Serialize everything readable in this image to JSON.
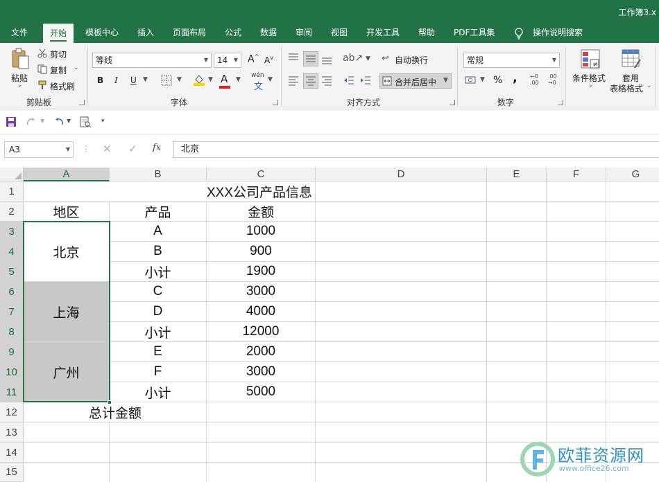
{
  "window": {
    "title": "工作簿3.x"
  },
  "tabs": [
    {
      "label": "文件"
    },
    {
      "label": "开始"
    },
    {
      "label": "模板中心"
    },
    {
      "label": "插入"
    },
    {
      "label": "页面布局"
    },
    {
      "label": "公式"
    },
    {
      "label": "数据"
    },
    {
      "label": "审阅"
    },
    {
      "label": "视图"
    },
    {
      "label": "开发工具"
    },
    {
      "label": "帮助"
    },
    {
      "label": "PDF工具集"
    },
    {
      "label": "操作说明搜索"
    }
  ],
  "active_tab": "开始",
  "ribbon": {
    "clipboard": {
      "paste": "粘贴",
      "cut": "剪切",
      "copy": "复制",
      "format_painter": "格式刷",
      "label": "剪贴板"
    },
    "font": {
      "name": "等线",
      "size": "14",
      "bold": "B",
      "italic": "I",
      "underline": "U",
      "label": "字体",
      "grow": "A",
      "shrink": "A",
      "font_color_letter": "A",
      "phonetic": "wén"
    },
    "alignment": {
      "wrap": "自动换行",
      "merge": "合并后居中",
      "label": "对齐方式"
    },
    "number": {
      "format": "常规",
      "percent": "%",
      "comma": ",",
      "label": "数字"
    },
    "styles": {
      "conditional": "条件格式",
      "table_line1": "套用",
      "table_line2": "表格格式"
    }
  },
  "formula_bar": {
    "name_box": "A3",
    "fx": "fx",
    "value": "北京"
  },
  "columns": [
    "A",
    "B",
    "C",
    "D",
    "E",
    "F",
    "G"
  ],
  "rows": [
    "1",
    "2",
    "3",
    "4",
    "5",
    "6",
    "7",
    "8",
    "9",
    "10",
    "11",
    "12",
    "13",
    "14",
    "15"
  ],
  "sheet": {
    "title": "XXX公司产品信息",
    "headers": [
      "地区",
      "产品",
      "金额"
    ],
    "regions": [
      "北京",
      "上海",
      "广州"
    ],
    "products": [
      "A",
      "B",
      "小计",
      "C",
      "D",
      "小计",
      "E",
      "F",
      "小计"
    ],
    "amounts": [
      "1000",
      "900",
      "1900",
      "3000",
      "4000",
      "12000",
      "2000",
      "3000",
      "5000"
    ],
    "total_label": "总计金额"
  },
  "colors": {
    "brand": "#217346",
    "region_fill": "#c8c8c8"
  },
  "watermark": {
    "text": "欧菲资源网",
    "url": "www.office26.com"
  }
}
